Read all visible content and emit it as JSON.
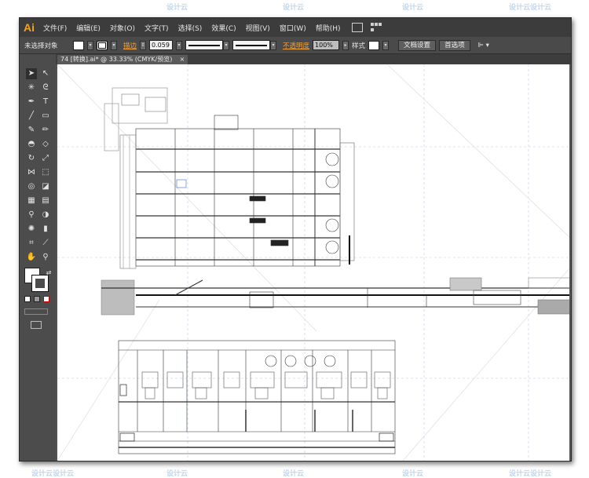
{
  "app": {
    "logo": "Ai",
    "menus": [
      "文件(F)",
      "编辑(E)",
      "对象(O)",
      "文字(T)",
      "选择(S)",
      "效果(C)",
      "视图(V)",
      "窗口(W)",
      "帮助(H)"
    ]
  },
  "control_bar": {
    "selection_status": "未选择对象",
    "stroke_label": "描边",
    "stroke_weight": "0.059",
    "stroke_profile": "等比",
    "brush": "基本",
    "opacity_label": "不透明度",
    "opacity_value": "100%",
    "style_label": "样式",
    "doc_setup_button": "文档设置",
    "preferences_button": "首选项"
  },
  "document": {
    "tab_title": "74 [转换].ai* @ 33.33% (CMYK/预览)",
    "close_glyph": "×"
  },
  "watermark": {
    "text": "设计云",
    "text_double": "设计云设计云"
  },
  "colors": {
    "accent_orange": "#f7a21b",
    "ui_dark": "#3c3c3c",
    "ui_panel": "#535353",
    "canvas": "#ffffff"
  }
}
